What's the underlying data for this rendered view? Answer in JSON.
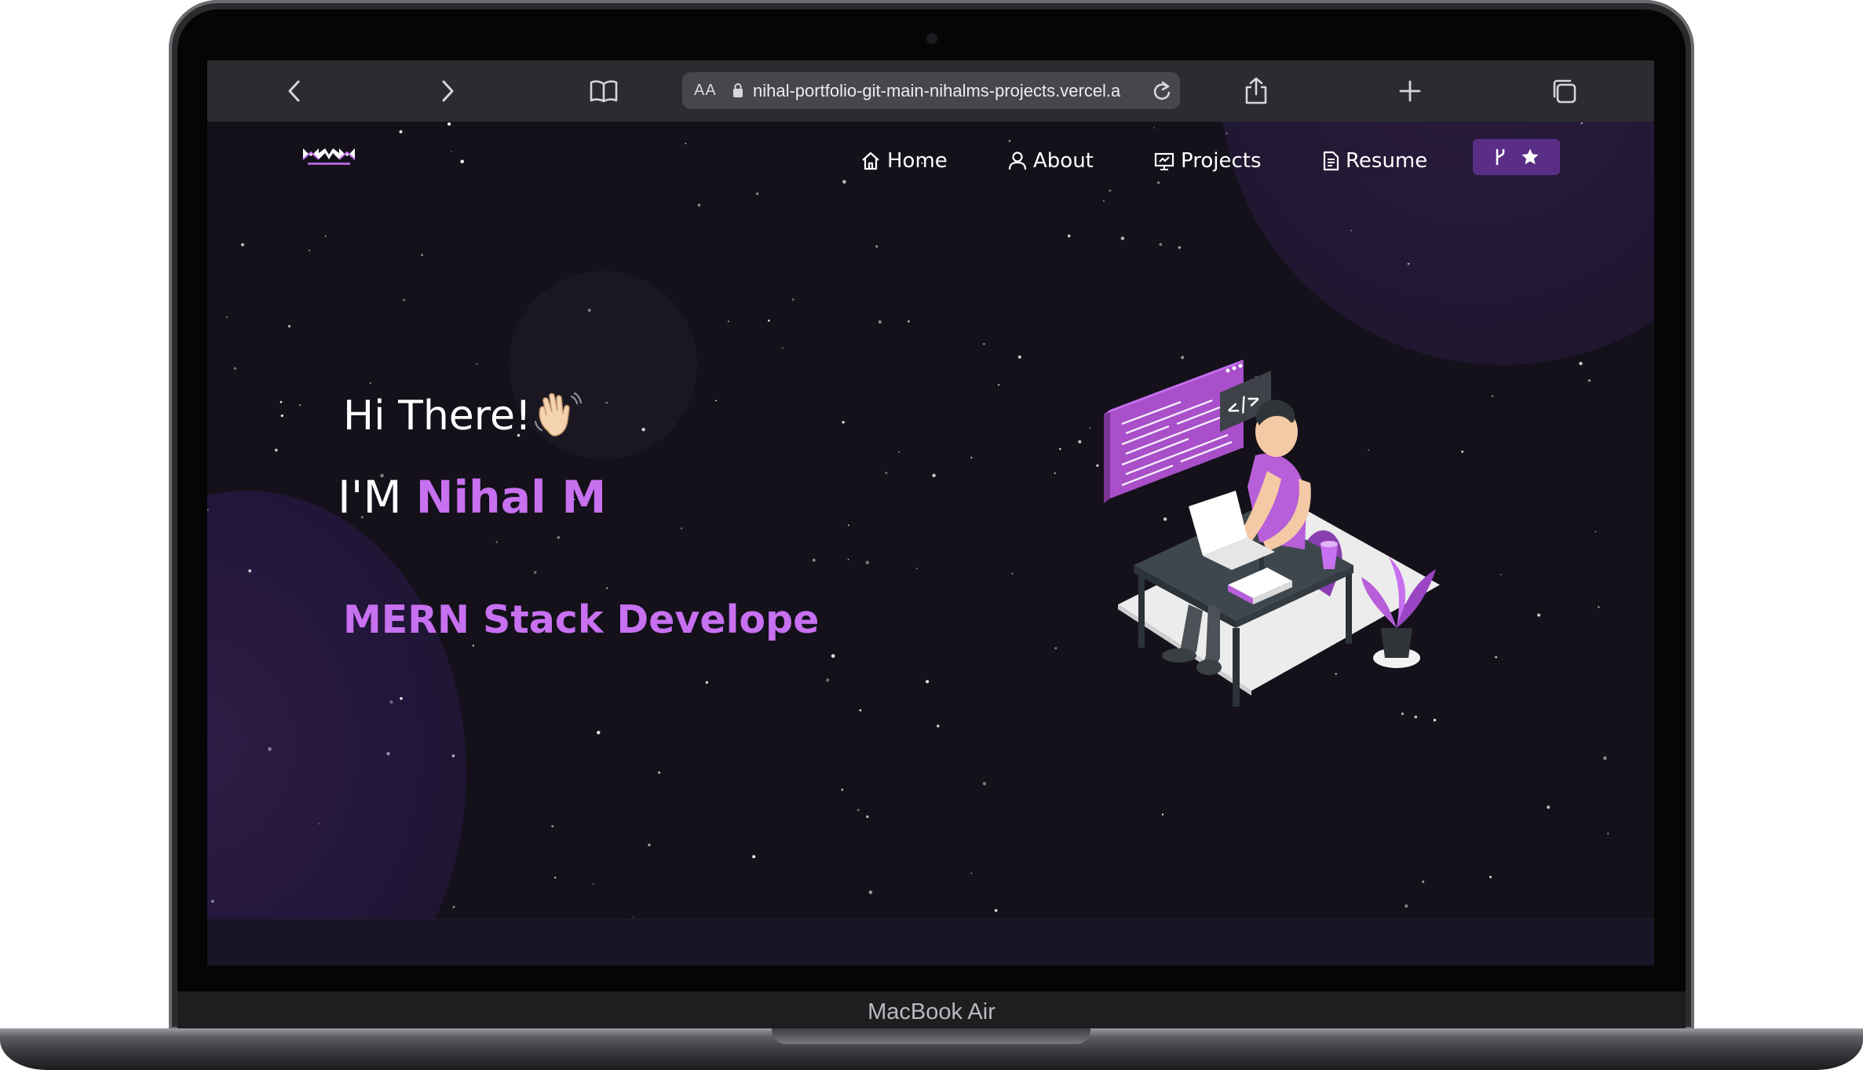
{
  "device": {
    "label": "MacBook Air"
  },
  "browser": {
    "url_aa": "AA",
    "url": "nihal-portfolio-git-main-nihalms-projects.vercel.a",
    "icons": [
      "back-icon",
      "forward-icon",
      "book-icon",
      "lock-icon",
      "reload-icon",
      "share-icon",
      "plus-icon",
      "tabs-icon"
    ]
  },
  "navbar": {
    "items": [
      {
        "label": "Home",
        "icon": "home-icon"
      },
      {
        "label": "About",
        "icon": "user-icon"
      },
      {
        "label": "Projects",
        "icon": "presentation-icon"
      },
      {
        "label": "Resume",
        "icon": "document-icon"
      }
    ],
    "fork_icons": [
      "git-fork-icon",
      "star-icon"
    ]
  },
  "hero": {
    "greeting": "Hi There!",
    "name_prefix": "I'M",
    "name": "Nihal M",
    "role": "MERN Stack Develope"
  },
  "colors": {
    "accent": "#c770f0",
    "background": "#14111a",
    "button": "#5a2e86"
  }
}
